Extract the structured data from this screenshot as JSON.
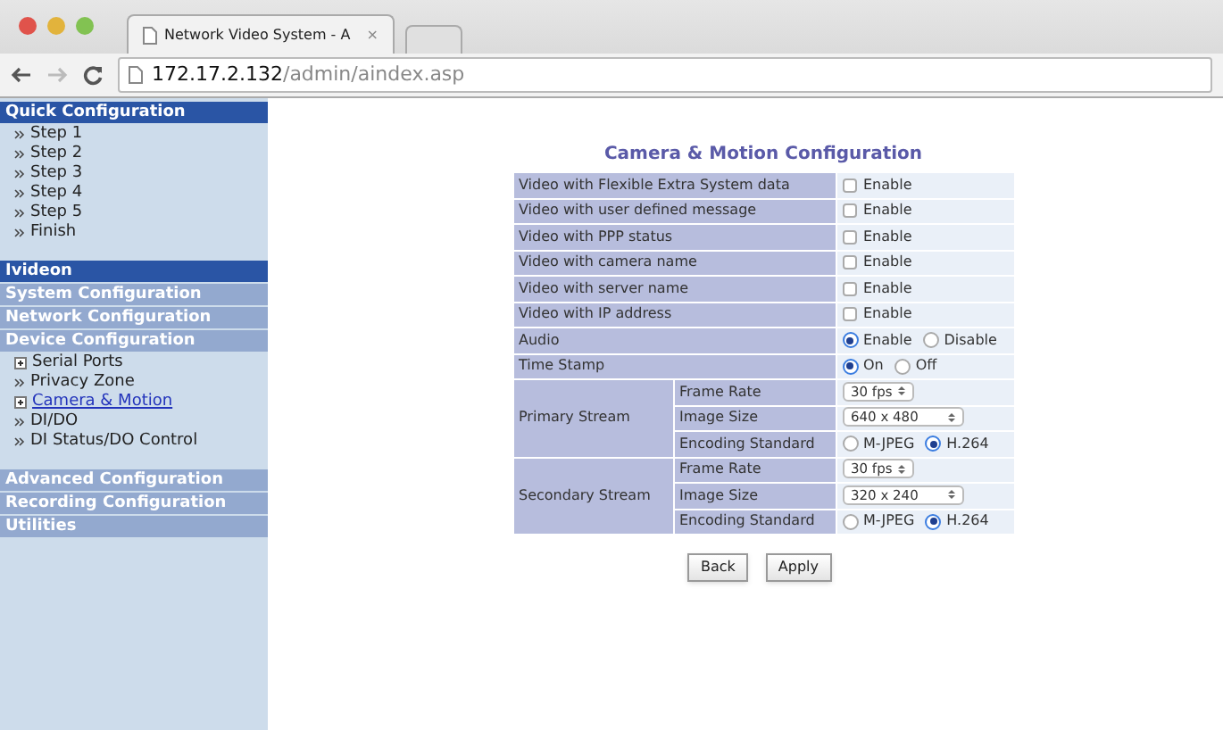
{
  "browser": {
    "tab_title": "Network Video System - A",
    "tab_close": "×",
    "url_host": "172.17.2.132",
    "url_path": "/admin/aindex.asp"
  },
  "sidebar": [
    {
      "title": "Quick Configuration",
      "selected": true,
      "items": [
        {
          "label": "Step 1",
          "kind": "arrow",
          "selected": false
        },
        {
          "label": "Step 2",
          "kind": "arrow",
          "selected": false
        },
        {
          "label": "Step 3",
          "kind": "arrow",
          "selected": false
        },
        {
          "label": "Step 4",
          "kind": "arrow",
          "selected": false
        },
        {
          "label": "Step 5",
          "kind": "arrow",
          "selected": false
        },
        {
          "label": "Finish",
          "kind": "arrow",
          "selected": false
        }
      ]
    },
    {
      "title": "Ivideon",
      "selected": true
    },
    {
      "title": "System Configuration",
      "selected": false
    },
    {
      "title": "Network Configuration",
      "selected": false
    },
    {
      "title": "Device Configuration",
      "selected": false,
      "items": [
        {
          "label": "Serial Ports",
          "kind": "expand",
          "selected": false
        },
        {
          "label": "Privacy Zone",
          "kind": "arrow",
          "selected": false
        },
        {
          "label": "Camera & Motion",
          "kind": "expand",
          "selected": true
        },
        {
          "label": "DI/DO",
          "kind": "arrow",
          "selected": false
        },
        {
          "label": "DI Status/DO Control",
          "kind": "arrow",
          "selected": false
        }
      ]
    },
    {
      "title": "Advanced Configuration",
      "selected": false
    },
    {
      "title": "Recording Configuration",
      "selected": false
    },
    {
      "title": "Utilities",
      "selected": false
    }
  ],
  "form": {
    "title": "Camera & Motion Configuration",
    "rows": [
      {
        "kind": "checkbox",
        "label": "Video with Flexible Extra System data",
        "option": "Enable",
        "checked": false
      },
      {
        "kind": "checkbox",
        "label": "Video with user defined message",
        "option": "Enable",
        "checked": false
      },
      {
        "kind": "checkbox",
        "label": "Video with PPP status",
        "option": "Enable",
        "checked": false
      },
      {
        "kind": "checkbox",
        "label": "Video with camera name",
        "option": "Enable",
        "checked": false
      },
      {
        "kind": "checkbox",
        "label": "Video with server name",
        "option": "Enable",
        "checked": false
      },
      {
        "kind": "checkbox",
        "label": "Video with IP address",
        "option": "Enable",
        "checked": false
      },
      {
        "kind": "radio",
        "label": "Audio",
        "options": [
          {
            "label": "Enable",
            "selected": true
          },
          {
            "label": "Disable",
            "selected": false
          }
        ]
      },
      {
        "kind": "radio",
        "label": "Time Stamp",
        "options": [
          {
            "label": "On",
            "selected": true
          },
          {
            "label": "Off",
            "selected": false
          }
        ]
      }
    ],
    "streams": [
      {
        "label": "Primary Stream",
        "fields": [
          {
            "kind": "select",
            "label": "Frame Rate",
            "value": "30 fps"
          },
          {
            "kind": "select",
            "label": "Image Size",
            "value": "640 x 480"
          },
          {
            "kind": "radio",
            "label": "Encoding Standard",
            "options": [
              {
                "label": "M-JPEG",
                "selected": false
              },
              {
                "label": "H.264",
                "selected": true
              }
            ]
          }
        ]
      },
      {
        "label": "Secondary Stream",
        "fields": [
          {
            "kind": "select",
            "label": "Frame Rate",
            "value": "30 fps"
          },
          {
            "kind": "select",
            "label": "Image Size",
            "value": "320 x 240"
          },
          {
            "kind": "radio",
            "label": "Encoding Standard",
            "options": [
              {
                "label": "M-JPEG",
                "selected": false
              },
              {
                "label": "H.264",
                "selected": true
              }
            ]
          }
        ]
      }
    ],
    "buttons": [
      "Back",
      "Apply"
    ]
  }
}
